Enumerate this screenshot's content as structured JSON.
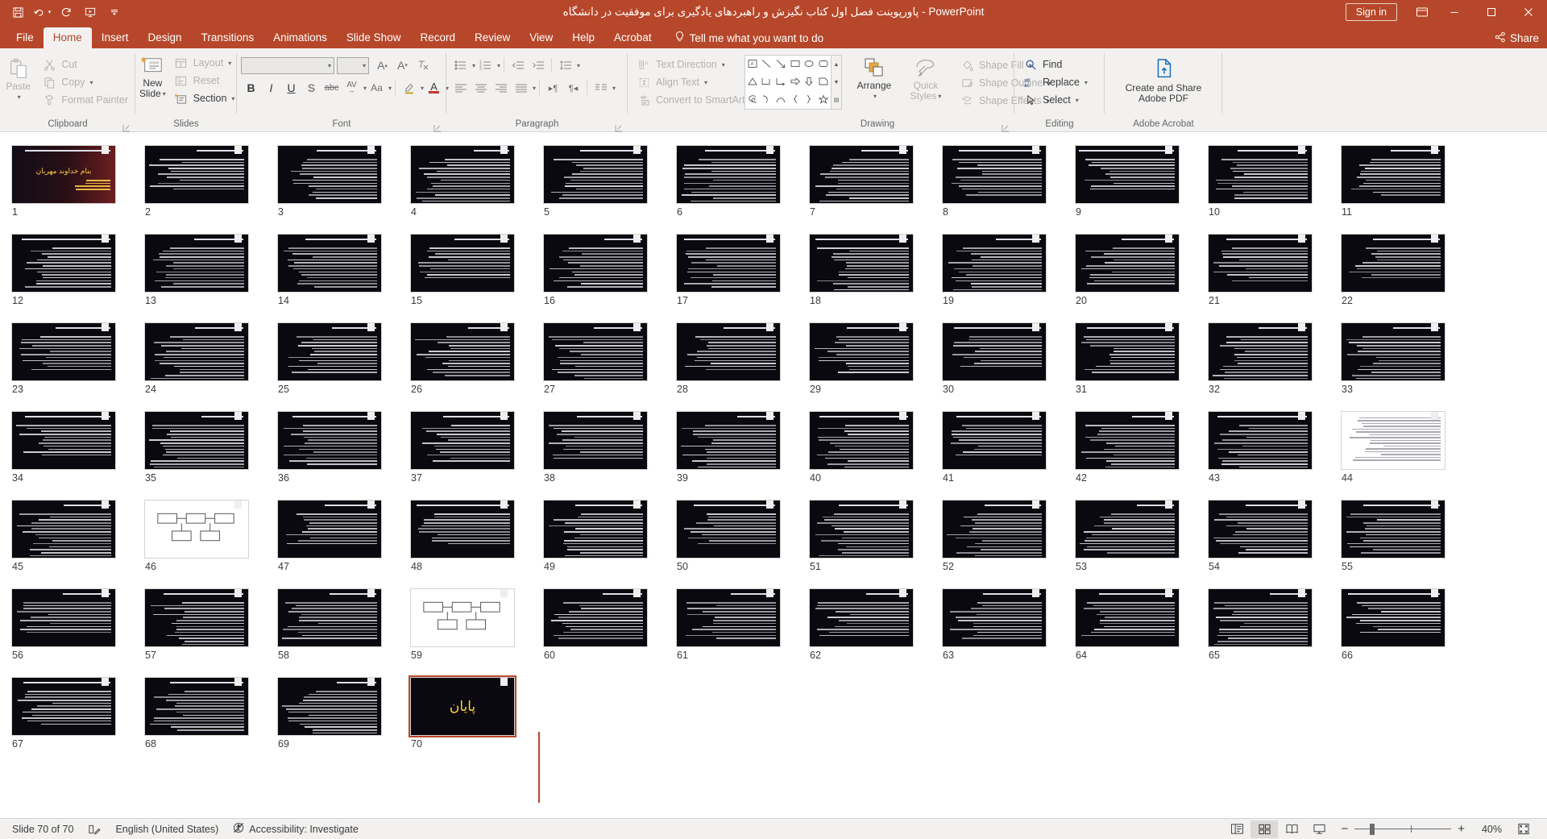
{
  "window": {
    "title": "پاورپوینت فصل اول کتاب نگیزش و راهبردهای یادگیری برای موفقیت در دانشگاه",
    "app_name": "PowerPoint",
    "title_separator": "-",
    "sign_in": "Sign in",
    "minimize": "minimize-icon",
    "restore": "restore-icon",
    "close": "close-icon",
    "ribbon_display": "ribbon-display-options-icon"
  },
  "quick_access": [
    {
      "name": "save-icon",
      "label": "Save"
    },
    {
      "name": "undo-icon",
      "label": "Undo"
    },
    {
      "name": "redo-icon",
      "label": "Redo"
    },
    {
      "name": "start-from-beginning-icon",
      "label": "Start From Beginning"
    },
    {
      "name": "customize-quick-access-toolbar-icon",
      "label": "Customize Quick Access Toolbar"
    }
  ],
  "tabs": [
    {
      "label": "File",
      "active": false
    },
    {
      "label": "Home",
      "active": true
    },
    {
      "label": "Insert",
      "active": false
    },
    {
      "label": "Design",
      "active": false
    },
    {
      "label": "Transitions",
      "active": false
    },
    {
      "label": "Animations",
      "active": false
    },
    {
      "label": "Slide Show",
      "active": false
    },
    {
      "label": "Record",
      "active": false
    },
    {
      "label": "Review",
      "active": false
    },
    {
      "label": "View",
      "active": false
    },
    {
      "label": "Help",
      "active": false
    },
    {
      "label": "Acrobat",
      "active": false
    }
  ],
  "tell_me": "Tell me what you want to do",
  "share": "Share",
  "ribbon": {
    "groups": [
      {
        "label": "Clipboard",
        "has_dialog_launcher": true
      },
      {
        "label": "Slides",
        "has_dialog_launcher": false
      },
      {
        "label": "Font",
        "has_dialog_launcher": true
      },
      {
        "label": "Paragraph",
        "has_dialog_launcher": true
      },
      {
        "label": "Drawing",
        "has_dialog_launcher": true
      },
      {
        "label": "Editing",
        "has_dialog_launcher": false
      },
      {
        "label": "Adobe Acrobat",
        "has_dialog_launcher": false
      }
    ],
    "clipboard": {
      "paste": "Paste",
      "cut": "Cut",
      "copy": "Copy",
      "format_painter": "Format Painter"
    },
    "slides": {
      "new_slide": "New\nSlide",
      "new_slide_line1": "New",
      "new_slide_line2": "Slide",
      "layout": "Layout",
      "reset": "Reset",
      "section": "Section"
    },
    "font": {
      "font_name": "",
      "font_size": "",
      "bold": "B",
      "italic": "I",
      "underline": "U",
      "shadow": "S",
      "strikethrough": "abc",
      "char_spacing": "AV",
      "change_case": "Aa",
      "text_highlight": "text-highlight-color-icon",
      "font_color": "A",
      "increase_size": "A",
      "decrease_size": "A",
      "clear_formatting": "clear-formatting-icon"
    },
    "paragraph": {
      "text_direction": "Text Direction",
      "align_text": "Align Text",
      "convert_to_smartart": "Convert to SmartArt"
    },
    "drawing": {
      "arrange": "Arrange",
      "quick_styles_line1": "Quick",
      "quick_styles_line2": "Styles",
      "shape_fill": "Shape Fill",
      "shape_outline": "Shape Outline",
      "shape_effects": "Shape Effects"
    },
    "editing": {
      "find": "Find",
      "replace": "Replace",
      "select": "Select"
    },
    "acrobat": {
      "line1": "Create and Share",
      "line2": "Adobe PDF"
    }
  },
  "status_bar": {
    "slide_indicator": "Slide 70 of 70",
    "notes_icon": "notes-icon",
    "language": "English (United States)",
    "accessibility": "Accessibility: Investigate",
    "zoom_level": "40%",
    "views": [
      {
        "name": "normal-view-button",
        "active": false
      },
      {
        "name": "slide-sorter-view-button",
        "active": true
      },
      {
        "name": "reading-view-button",
        "active": false
      },
      {
        "name": "slide-show-button",
        "active": false
      }
    ],
    "fit_to_window": "fit-slide-to-window-button"
  },
  "sorter": {
    "total_slides": 70,
    "selected_slide": 70,
    "slides": [
      {
        "n": 1,
        "kind": "title-dark",
        "title": "بنام خداوند مهربان"
      },
      {
        "n": 2,
        "kind": "text",
        "title": "خودآموزهای تحصیلی چیست"
      },
      {
        "n": 3,
        "kind": "text",
        "title": ""
      },
      {
        "n": 4,
        "kind": "text",
        "title": "خودآموزهای تحصیلی چیست؟"
      },
      {
        "n": 5,
        "kind": "text",
        "title": ""
      },
      {
        "n": 6,
        "kind": "text",
        "title": ""
      },
      {
        "n": 7,
        "kind": "text",
        "title": ""
      },
      {
        "n": 8,
        "kind": "text",
        "title": ""
      },
      {
        "n": 9,
        "kind": "text",
        "title": ""
      },
      {
        "n": 10,
        "kind": "text",
        "title": "هدفمند شدن و دانگاه موسسه"
      },
      {
        "n": 11,
        "kind": "text",
        "title": ""
      },
      {
        "n": 12,
        "kind": "text",
        "title": ""
      },
      {
        "n": 13,
        "kind": "text",
        "title": ""
      },
      {
        "n": 14,
        "kind": "text",
        "title": ""
      },
      {
        "n": 15,
        "kind": "text",
        "title": ""
      },
      {
        "n": 16,
        "kind": "text",
        "title": ""
      },
      {
        "n": 17,
        "kind": "text",
        "title": ""
      },
      {
        "n": 18,
        "kind": "text",
        "title": ""
      },
      {
        "n": 19,
        "kind": "text",
        "title": ""
      },
      {
        "n": 20,
        "kind": "text",
        "title": "افزایش"
      },
      {
        "n": 21,
        "kind": "text",
        "title": ""
      },
      {
        "n": 22,
        "kind": "text",
        "title": ""
      },
      {
        "n": 23,
        "kind": "text",
        "title": ""
      },
      {
        "n": 24,
        "kind": "text",
        "title": ""
      },
      {
        "n": 25,
        "kind": "text",
        "title": ""
      },
      {
        "n": 26,
        "kind": "text",
        "title": ""
      },
      {
        "n": 27,
        "kind": "text",
        "title": "نحوه ارزیابی"
      },
      {
        "n": 28,
        "kind": "text",
        "title": ""
      },
      {
        "n": 29,
        "kind": "text",
        "title": ""
      },
      {
        "n": 30,
        "kind": "text",
        "title": "استفاده از زمان"
      },
      {
        "n": 31,
        "kind": "text",
        "title": ""
      },
      {
        "n": 32,
        "kind": "text",
        "title": ""
      },
      {
        "n": 33,
        "kind": "text",
        "title": "محیط آموزش و کتابخانه"
      },
      {
        "n": 34,
        "kind": "text",
        "title": ""
      },
      {
        "n": 35,
        "kind": "text",
        "title": ""
      },
      {
        "n": 36,
        "kind": "text",
        "title": "تفکر در مورد مشکلات"
      },
      {
        "n": 37,
        "kind": "text",
        "title": ""
      },
      {
        "n": 38,
        "kind": "text",
        "title": ""
      },
      {
        "n": 39,
        "kind": "text",
        "title": "خودآموزهای تحصیلی"
      },
      {
        "n": 40,
        "kind": "text",
        "title": ""
      },
      {
        "n": 41,
        "kind": "text",
        "title": ""
      },
      {
        "n": 42,
        "kind": "text",
        "title": "ویژگی‌های دانشجویان"
      },
      {
        "n": 43,
        "kind": "text",
        "title": ""
      },
      {
        "n": 44,
        "kind": "light",
        "title": ""
      },
      {
        "n": 45,
        "kind": "text",
        "title": ""
      },
      {
        "n": 46,
        "kind": "diagram-light",
        "title": ""
      },
      {
        "n": 47,
        "kind": "text",
        "title": ""
      },
      {
        "n": 48,
        "kind": "text",
        "title": ""
      },
      {
        "n": 49,
        "kind": "text",
        "title": ""
      },
      {
        "n": 50,
        "kind": "text",
        "title": ""
      },
      {
        "n": 51,
        "kind": "text",
        "title": ""
      },
      {
        "n": 52,
        "kind": "text",
        "title": ""
      },
      {
        "n": 53,
        "kind": "text",
        "title": ""
      },
      {
        "n": 54,
        "kind": "text",
        "title": ""
      },
      {
        "n": 55,
        "kind": "text",
        "title": ""
      },
      {
        "n": 56,
        "kind": "text",
        "title": ""
      },
      {
        "n": 57,
        "kind": "text",
        "title": ""
      },
      {
        "n": 58,
        "kind": "text",
        "title": ""
      },
      {
        "n": 59,
        "kind": "diagram-light",
        "title": ""
      },
      {
        "n": 60,
        "kind": "text",
        "title": ""
      },
      {
        "n": 61,
        "kind": "text",
        "title": ""
      },
      {
        "n": 62,
        "kind": "text",
        "title": ""
      },
      {
        "n": 63,
        "kind": "text",
        "title": ""
      },
      {
        "n": 64,
        "kind": "text",
        "title": ""
      },
      {
        "n": 65,
        "kind": "text",
        "title": ""
      },
      {
        "n": 66,
        "kind": "text",
        "title": ""
      },
      {
        "n": 67,
        "kind": "text",
        "title": ""
      },
      {
        "n": 68,
        "kind": "text",
        "title": ""
      },
      {
        "n": 69,
        "kind": "text",
        "title": ""
      },
      {
        "n": 70,
        "kind": "end",
        "title": "پایان"
      }
    ]
  },
  "colors": {
    "brand": "#b7472a",
    "ribbon_bg": "#f2f1f0",
    "slide_bg": "#0b0910",
    "accent_text": "#ffd24a"
  }
}
